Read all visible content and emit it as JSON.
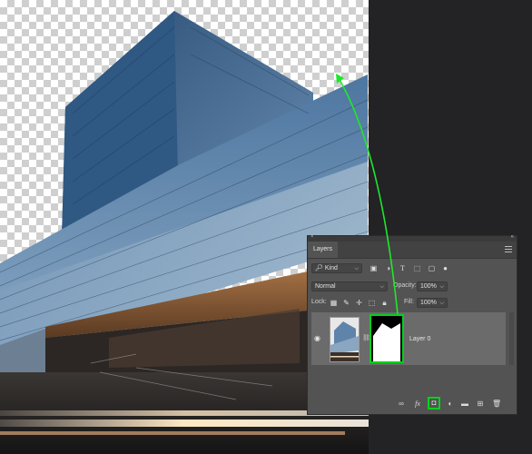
{
  "canvas": {
    "photo_subject": "glass office building"
  },
  "layers_panel": {
    "close_glyph": "×",
    "collapse_glyph": "«",
    "tab_label": "Layers",
    "filter": {
      "value": "Kind",
      "icons": [
        "image-filter-icon",
        "adjustment-filter-icon",
        "type-filter-icon",
        "shape-filter-icon",
        "smart-object-filter-icon",
        "filter-toggle-icon"
      ]
    },
    "blend_mode": "Normal",
    "opacity_label": "Opacity:",
    "opacity_value": "100%",
    "lock_label": "Lock:",
    "fill_label": "Fill:",
    "fill_value": "100%",
    "layers": [
      {
        "name": "Layer 0",
        "visible": true,
        "has_mask": true
      }
    ],
    "bottom_icons": [
      "link-layers-icon",
      "fx-icon",
      "add-mask-icon",
      "adjustment-layer-icon",
      "new-group-icon",
      "new-layer-icon",
      "delete-layer-icon"
    ],
    "fx_label": "fx"
  },
  "colors": {
    "highlight": "#00d21b",
    "panel_bg": "#535353",
    "workspace_bg": "#232225"
  }
}
